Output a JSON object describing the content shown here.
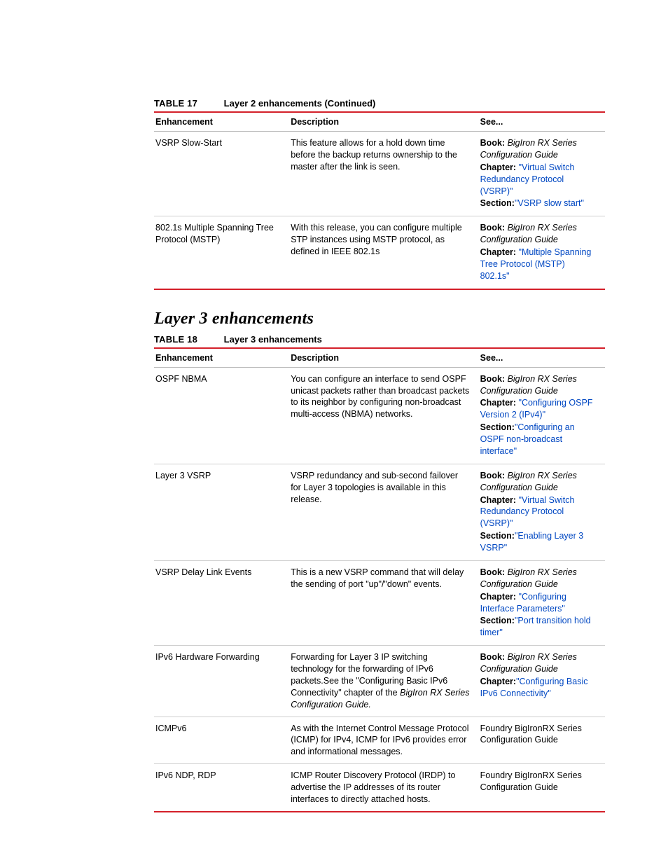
{
  "table17": {
    "label": "TABLE 17",
    "title": "Layer 2 enhancements (Continued)",
    "headers": {
      "c1": "Enhancement",
      "c2": "Description",
      "c3": "See..."
    },
    "rows": [
      {
        "enh": "VSRP Slow-Start",
        "desc": "This feature allows for a hold down time before the backup returns ownership to the master after the link is seen.",
        "ref": {
          "book_label": "Book:",
          "book_title": "BigIron RX Series Configuration Guide",
          "chapter_label": "Chapter:",
          "chapter_link": "\"Virtual Switch Redundancy Protocol (VSRP)\"",
          "section_label": "Section:",
          "section_link": "\"VSRP slow start\""
        }
      },
      {
        "enh": "802.1s Multiple Spanning Tree Protocol (MSTP)",
        "desc": "With this release, you can configure multiple STP instances using MSTP protocol, as defined in IEEE 802.1s",
        "ref": {
          "book_label": "Book:",
          "book_title": "BigIron RX Series Configuration Guide",
          "chapter_label": "Chapter:",
          "chapter_link": "\"Multiple Spanning Tree Protocol (MSTP) 802.1s\""
        }
      }
    ]
  },
  "section_heading": "Layer 3 enhancements",
  "table18": {
    "label": "TABLE 18",
    "title": "Layer 3 enhancements",
    "headers": {
      "c1": "Enhancement",
      "c2": "Description",
      "c3": "See..."
    },
    "rows": [
      {
        "enh": "OSPF NBMA",
        "desc": "You can configure an interface to send OSPF unicast packets rather than broadcast packets to its neighbor by configuring non-broadcast multi-access (NBMA) networks.",
        "ref": {
          "book_label": "Book:",
          "book_title": "BigIron RX Series Configuration Guide",
          "chapter_label": "Chapter:",
          "chapter_link": "\"Configuring OSPF Version 2 (IPv4)\"",
          "section_label": "Section:",
          "section_link": "\"Configuring an OSPF non-broadcast interface\""
        }
      },
      {
        "enh": "Layer 3 VSRP",
        "desc": "VSRP redundancy and sub-second failover for Layer 3 topologies is available in this release.",
        "ref": {
          "book_label": "Book:",
          "book_title": "BigIron RX Series Configuration Guide",
          "chapter_label": "Chapter:",
          "chapter_link": "\"Virtual Switch Redundancy Protocol (VSRP)\"",
          "section_label": "Section:",
          "section_link": "\"Enabling Layer 3 VSRP\""
        }
      },
      {
        "enh": "VSRP Delay Link Events",
        "desc": "This is a new VSRP command that will delay the sending of port \"up\"/\"down\" events.",
        "ref": {
          "book_label": "Book:",
          "book_title": "BigIron RX Series Configuration Guide",
          "chapter_label": "Chapter:",
          "chapter_link": "\"Configuring Interface Parameters\"",
          "section_label": "Section:",
          "section_link": "\"Port transition hold timer\""
        }
      },
      {
        "enh": "IPv6 Hardware Forwarding",
        "desc_pre": "Forwarding for Layer 3 IP switching technology for the forwarding of IPv6 packets.See the \"Configuring Basic IPv6 Connectivity\" chapter of the ",
        "desc_italic": "BigIron RX Series Configuration Guide.",
        "ref": {
          "book_label": "Book:",
          "book_title": "BigIron RX Series Configuration Guide",
          "chapter_label": "Chapter:",
          "chapter_link": "\"Configuring Basic IPv6 Connectivity\""
        }
      },
      {
        "enh": "ICMPv6",
        "desc": "As with the Internet Control Message Protocol (ICMP) for IPv4, ICMP for IPv6 provides error and informational messages.",
        "ref_plain": "Foundry BigIronRX Series Configuration Guide"
      },
      {
        "enh": "IPv6 NDP, RDP",
        "desc": "ICMP Router Discovery Protocol (IRDP) to advertise the IP addresses of its router interfaces to directly attached hosts.",
        "ref_plain": "Foundry BigIronRX Series Configuration Guide"
      }
    ]
  }
}
